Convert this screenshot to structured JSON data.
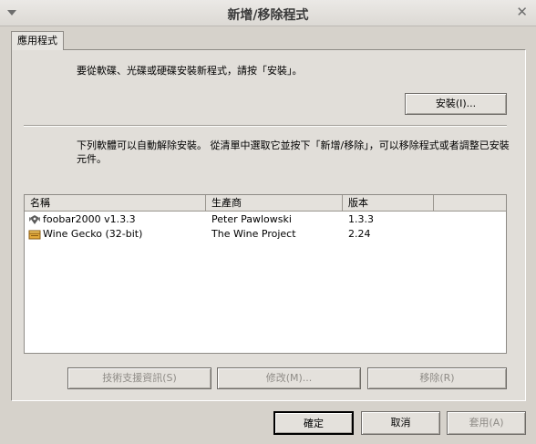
{
  "window": {
    "title": "新增/移除程式"
  },
  "tab": {
    "label": "應用程式"
  },
  "install_section": {
    "instruction": "要從軟碟、光碟或硬碟安裝新程式，請按「安裝」。",
    "install_button": "安裝(I)..."
  },
  "remove_section": {
    "instruction": "下列軟體可以自動解除安裝。 從清單中選取它並按下「新增/移除」，可以移除程式或者調整已安裝元件。"
  },
  "list": {
    "headers": [
      "名稱",
      "生產商",
      "版本"
    ],
    "rows": [
      {
        "name": "foobar2000 v1.3.3",
        "publisher": "Peter Pawlowski",
        "version": "1.3.3",
        "icon": "foobar-icon"
      },
      {
        "name": "Wine Gecko (32-bit)",
        "publisher": "The Wine Project",
        "version": "2.24",
        "icon": "package-icon"
      }
    ]
  },
  "actions": {
    "support_info": "技術支援資訊(S)",
    "modify": "修改(M)...",
    "remove": "移除(R)"
  },
  "dialog": {
    "ok": "確定",
    "cancel": "取消",
    "apply": "套用(A)"
  }
}
